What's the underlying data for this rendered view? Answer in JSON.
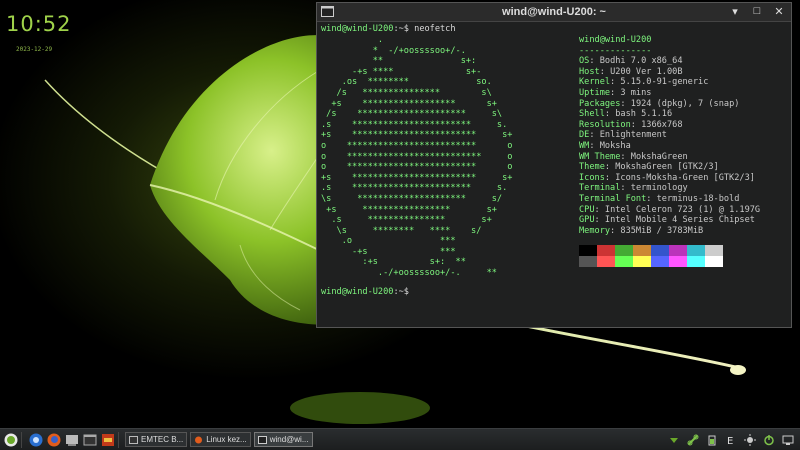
{
  "clock": {
    "time": "10:52",
    "date": "2023-12-29"
  },
  "terminal": {
    "title": "wind@wind-U200: ~",
    "buttons": {
      "minimize": "▾",
      "maximize": "□",
      "close": "✕"
    },
    "prompt_user": "wind@wind-U200",
    "prompt_path": ":~$",
    "command": " neofetch",
    "ascii_art": "           .\n          *  -/+oossssoo+/-.\n          **               s+:\n      -+s ****              s+-\n    .os  ********             so.\n   /s   ***************        s\\\n  +s    ******************      s+\n /s    *********************     s\\\n.s    ***********************     s.\n+s    ************************     s+\no    *************************      o\no    **************************     o\no    *************************      o\n+s    ************************     s+\n.s    ***********************     s.\n\\s     *********************     s/\n +s     *****************       s+\n  .s     ***************       s+\n   \\s     ********   ****    s/\n    .o                 ***\n      -+s              ***\n        :+s          s+:  **\n           .-/+oossssoo+/-.     **",
    "info_header": "wind@wind-U200",
    "info_separator": "--------------",
    "info": [
      {
        "k": "OS",
        "v": "Bodhi 7.0 x86_64"
      },
      {
        "k": "Host",
        "v": "U200 Ver 1.00B"
      },
      {
        "k": "Kernel",
        "v": "5.15.0-91-generic"
      },
      {
        "k": "Uptime",
        "v": "3 mins"
      },
      {
        "k": "Packages",
        "v": "1924 (dpkg), 7 (snap)"
      },
      {
        "k": "Shell",
        "v": "bash 5.1.16"
      },
      {
        "k": "Resolution",
        "v": "1366x768"
      },
      {
        "k": "DE",
        "v": "Enlightenment"
      },
      {
        "k": "WM",
        "v": "Moksha"
      },
      {
        "k": "WM Theme",
        "v": "MokshaGreen"
      },
      {
        "k": "Theme",
        "v": "MokshaGreen [GTK2/3]"
      },
      {
        "k": "Icons",
        "v": "Icons-Moksha-Green [GTK2/3]"
      },
      {
        "k": "Terminal",
        "v": "terminology"
      },
      {
        "k": "Terminal Font",
        "v": "terminus-18-bold"
      },
      {
        "k": "CPU",
        "v": "Intel Celeron 723 (1) @ 1.197G"
      },
      {
        "k": "GPU",
        "v": "Intel Mobile 4 Series Chipset"
      },
      {
        "k": "Memory",
        "v": "835MiB / 3783MiB"
      }
    ],
    "palette_row1": [
      "#000000",
      "#cc3333",
      "#44aa33",
      "#cc8833",
      "#3355cc",
      "#bb33bb",
      "#33bbcc",
      "#cccccc"
    ],
    "palette_row2": [
      "#555555",
      "#ff5555",
      "#66ff55",
      "#ffff55",
      "#5566ff",
      "#ff55ff",
      "#55ffff",
      "#ffffff"
    ]
  },
  "taskbar": {
    "tasks": [
      {
        "label": "EMTEC B..."
      },
      {
        "label": "Linux kez..."
      },
      {
        "label": "wind@wi..."
      }
    ],
    "icons": [
      "start-icon",
      "browser-icon",
      "firefox-icon",
      "file-manager-icon",
      "terminal-icon",
      "app-icon"
    ],
    "tray": [
      "update-icon",
      "network-icon",
      "battery-icon",
      "keyboard-icon",
      "brightness-icon",
      "power-icon",
      "desktop-icon"
    ]
  }
}
